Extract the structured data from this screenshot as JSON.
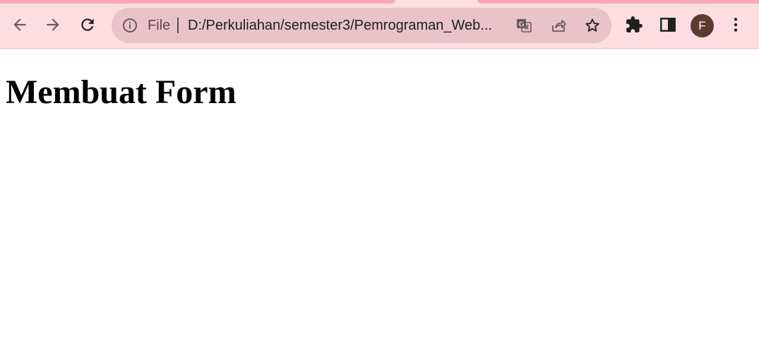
{
  "colors": {
    "tabstrip": "#f9aab8",
    "toolbar_bg": "#fcdde2",
    "omnibox_bg": "#e8c3c9",
    "icon": "#1f1f1f",
    "icon_muted": "#6b5a5d",
    "avatar_bg": "#5d3a2f",
    "page_bg": "#ffffff"
  },
  "toolbar": {
    "back_icon": "arrow-left",
    "forward_icon": "arrow-right",
    "reload_icon": "reload",
    "extensions_icon": "puzzle",
    "side_panel_icon": "side-panel",
    "menu_icon": "kebab-menu"
  },
  "omnibox": {
    "info_icon": "info-circle",
    "scheme": "File",
    "url": "D:/Perkuliahan/semester3/Pemrograman_Web...",
    "translate_icon": "translate",
    "share_icon": "share",
    "bookmark_icon": "star"
  },
  "profile": {
    "initial": "F"
  },
  "page": {
    "heading": "Membuat Form"
  }
}
